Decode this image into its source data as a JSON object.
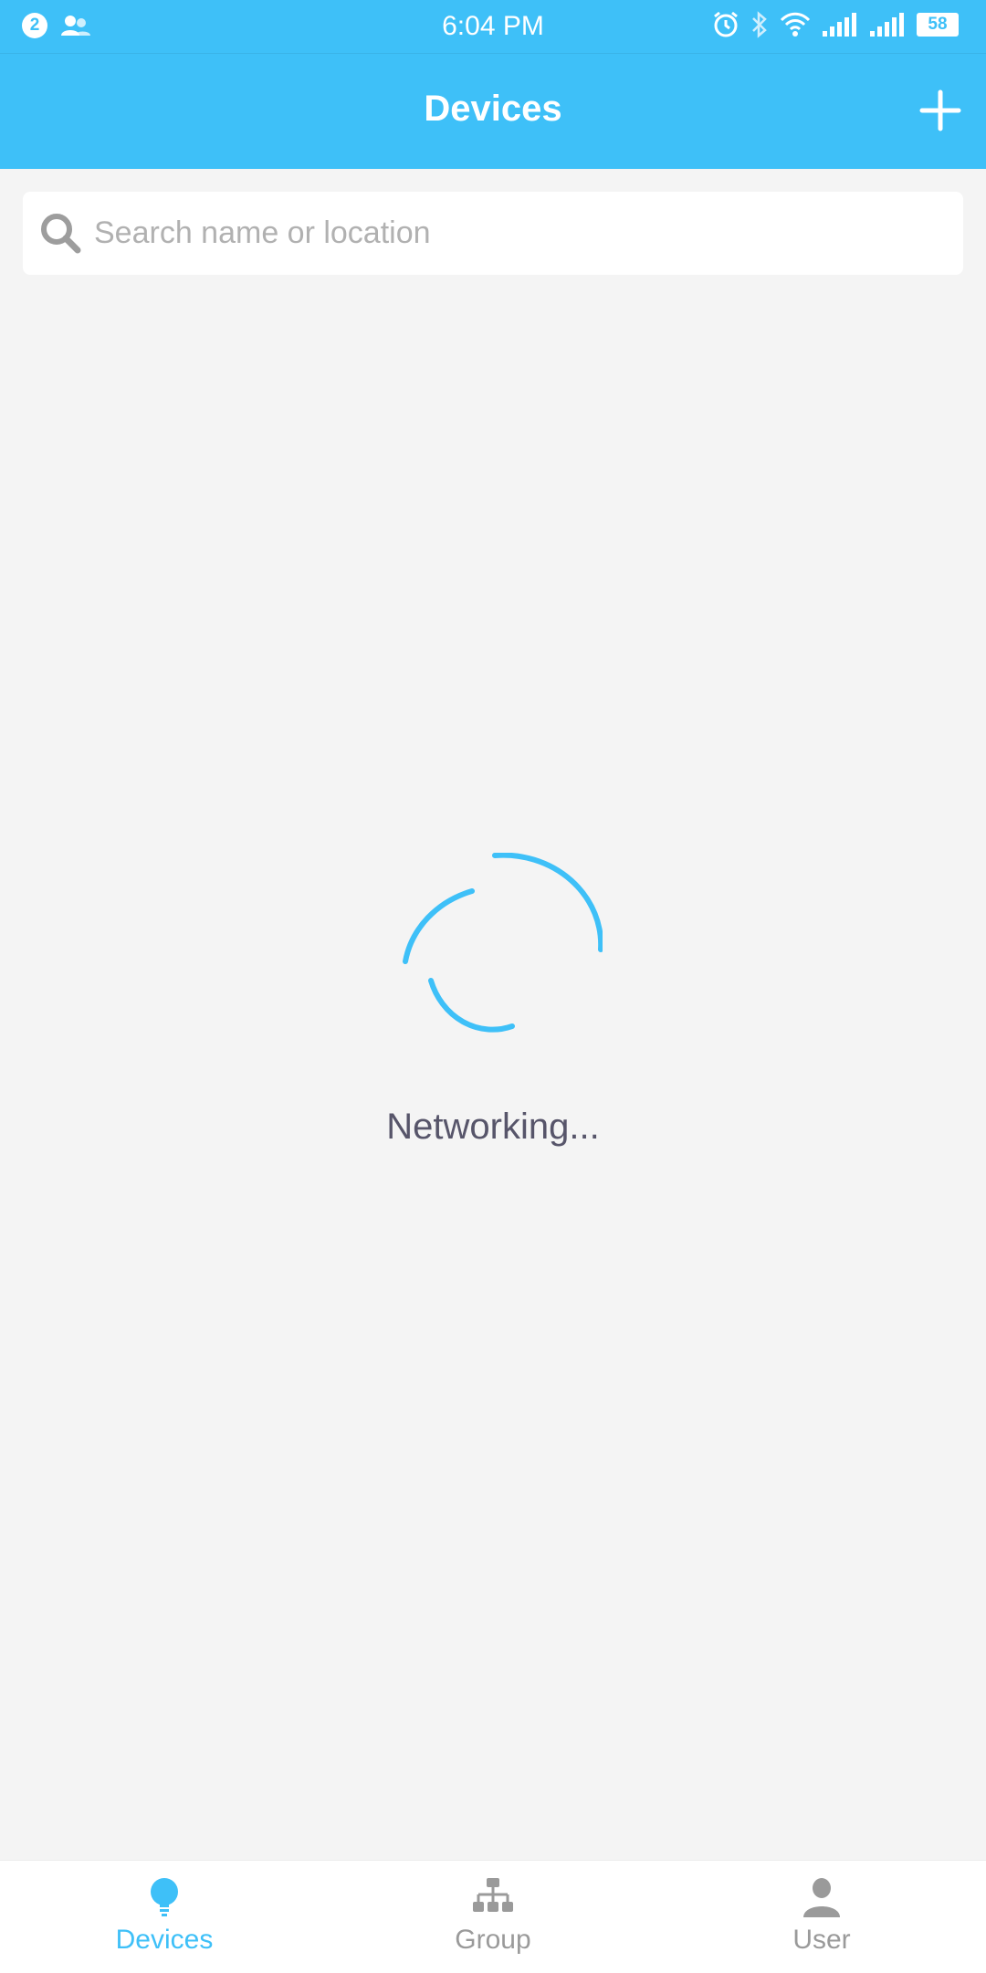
{
  "status_bar": {
    "notification_count": "2",
    "time": "6:04 PM",
    "battery": "58",
    "icons": [
      "contacts-icon",
      "alarm-icon",
      "bluetooth-icon",
      "wifi-icon",
      "signal-1-icon",
      "signal-2-icon",
      "battery-icon"
    ]
  },
  "header": {
    "title": "Devices",
    "add_icon": "plus-icon"
  },
  "search": {
    "placeholder": "Search name or location",
    "value": "",
    "icon": "search-icon"
  },
  "loading": {
    "text": "Networking..."
  },
  "tabs": [
    {
      "label": "Devices",
      "icon": "lightbulb-icon",
      "active": true
    },
    {
      "label": "Group",
      "icon": "group-hierarchy-icon",
      "active": false
    },
    {
      "label": "User",
      "icon": "user-icon",
      "active": false
    }
  ],
  "colors": {
    "accent": "#3ec0f8",
    "background": "#f4f4f4",
    "text_muted": "#9a9a9a",
    "text_loading": "#57556a"
  }
}
